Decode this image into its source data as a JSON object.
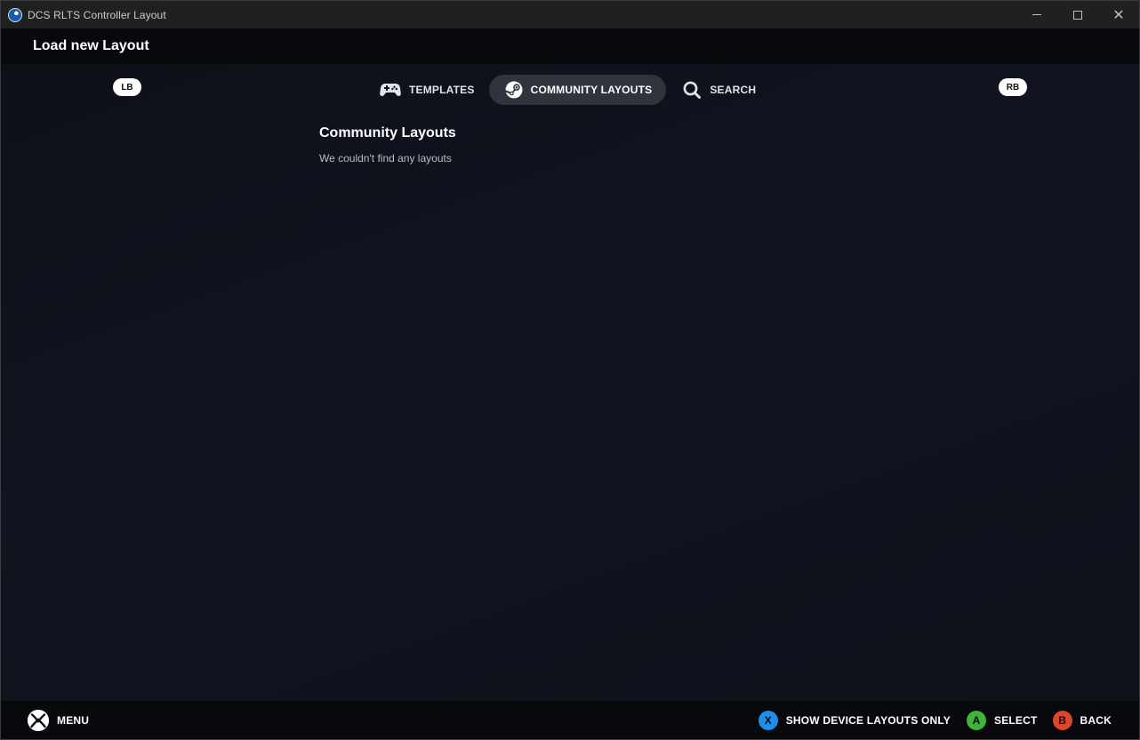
{
  "window": {
    "title": "DCS RLTS Controller Layout",
    "minimize_glyph": "minimize",
    "maximize_glyph": "maximize",
    "close_glyph": "✕"
  },
  "header": {
    "title": "Load new Layout"
  },
  "bumpers": {
    "left": "LB",
    "right": "RB"
  },
  "tabs": [
    {
      "label": "TEMPLATES",
      "icon": "gamepad-icon",
      "active": false
    },
    {
      "label": "COMMUNITY LAYOUTS",
      "icon": "steam-icon",
      "active": true
    },
    {
      "label": "SEARCH",
      "icon": "search-icon",
      "active": false
    }
  ],
  "main": {
    "section_title": "Community Layouts",
    "empty_message": "We couldn't find any layouts"
  },
  "footer": {
    "menu_label": "MENU",
    "menu_icon": "xbox-icon",
    "actions": [
      {
        "button": "X",
        "label": "SHOW DEVICE LAYOUTS ONLY",
        "color": "#1f8ee8"
      },
      {
        "button": "A",
        "label": "SELECT",
        "color": "#3fb33a"
      },
      {
        "button": "B",
        "label": "BACK",
        "color": "#e0442b"
      }
    ]
  },
  "colors": {
    "background": "#0e1118",
    "active_tab": "#30343c",
    "header": "#07090d"
  }
}
